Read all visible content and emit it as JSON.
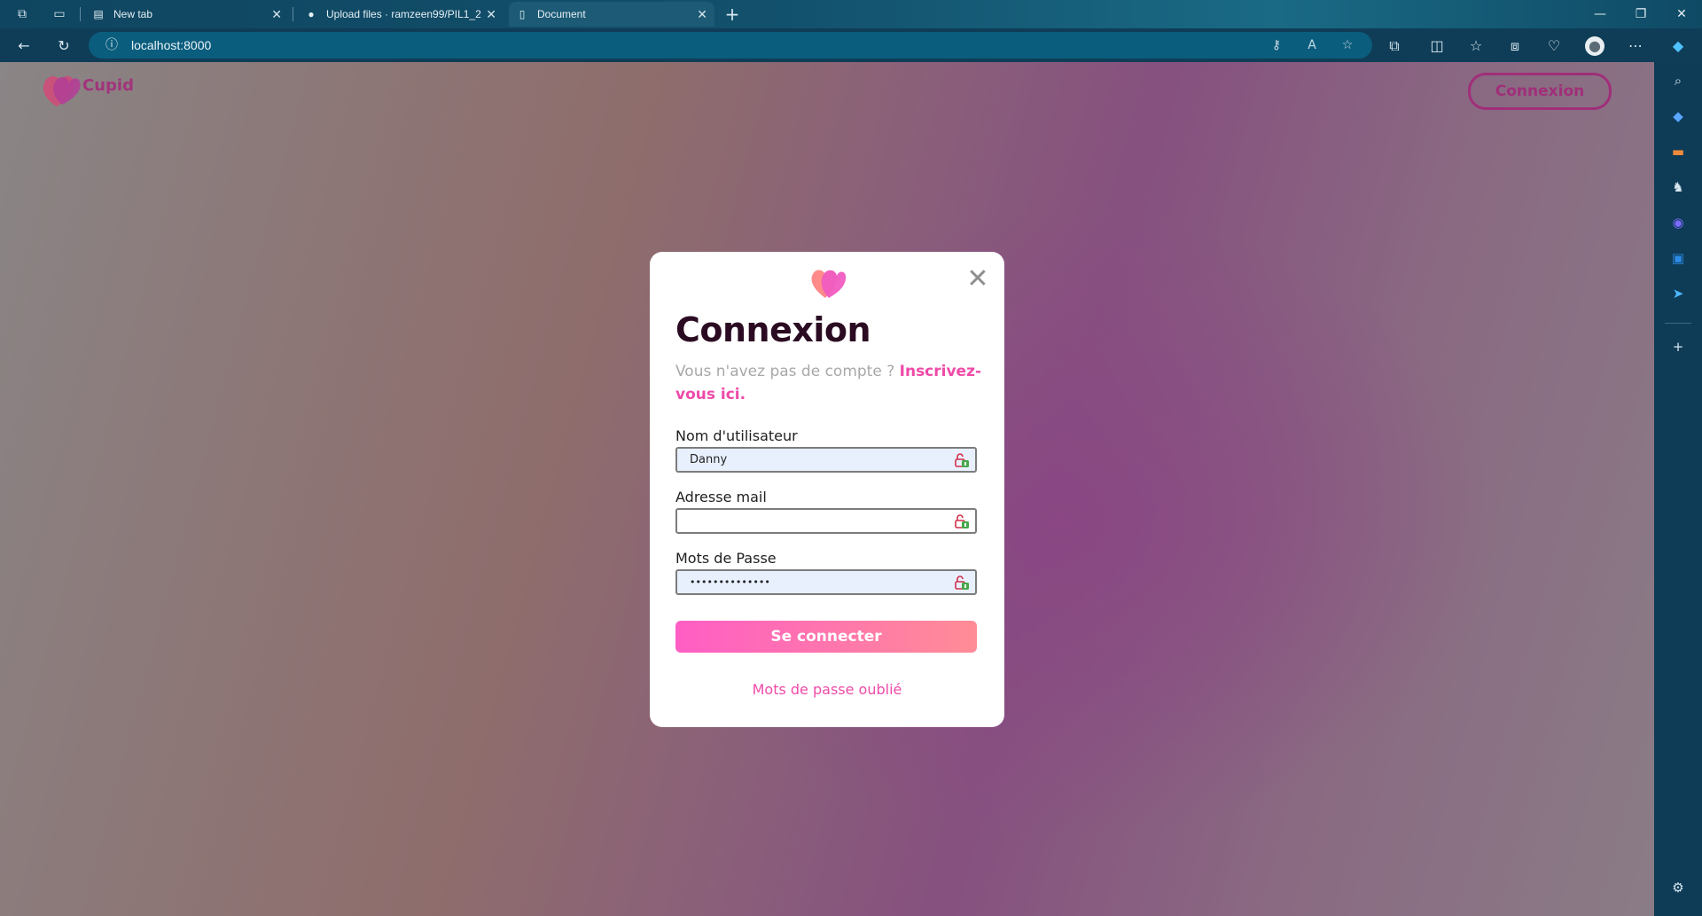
{
  "browser": {
    "tabs": [
      {
        "label": "New tab",
        "active": false
      },
      {
        "label": "Upload files · ramzeen99/PIL1_2",
        "active": false
      },
      {
        "label": "Document",
        "active": true
      }
    ],
    "new_tab_label": "+",
    "url": "localhost:8000"
  },
  "header": {
    "logo_text": "Cupid",
    "connexion_label": "Connexion"
  },
  "modal": {
    "title": "Connexion",
    "subtitle_text": "Vous n'avez pas de compte ? ",
    "subtitle_link": "Inscrivez-vous ici.",
    "fields": [
      {
        "label": "Nom d'utilisateur",
        "value": "Danny",
        "placeholder": ""
      },
      {
        "label": "Adresse mail",
        "value": "",
        "placeholder": ""
      },
      {
        "label": "Mots de Passe",
        "value": "••••••••••••••",
        "placeholder": ""
      }
    ],
    "submit_label": "Se connecter",
    "forgot_label": "Mots de passe oublié",
    "close_glyph": "✕"
  },
  "colors": {
    "brand_pink": "#ee4aa8",
    "brand_dark": "#a02e79",
    "title": "#2b0b22"
  },
  "icons": {
    "toolbar": [
      "back-icon",
      "refresh-icon",
      "info-icon",
      "key-icon",
      "read-aloud-icon",
      "favorite-star-icon",
      "extensions-icon",
      "split-screen-icon",
      "favorites-icon",
      "collections-icon",
      "browser-essentials-icon",
      "profile-icon",
      "more-icon",
      "copilot-icon"
    ],
    "sidebar": [
      "search-icon",
      "shopping-tag-icon",
      "tools-icon",
      "games-icon",
      "microsoft365-icon",
      "outlook-icon",
      "telegram-icon",
      "add-icon",
      "settings-icon"
    ]
  }
}
